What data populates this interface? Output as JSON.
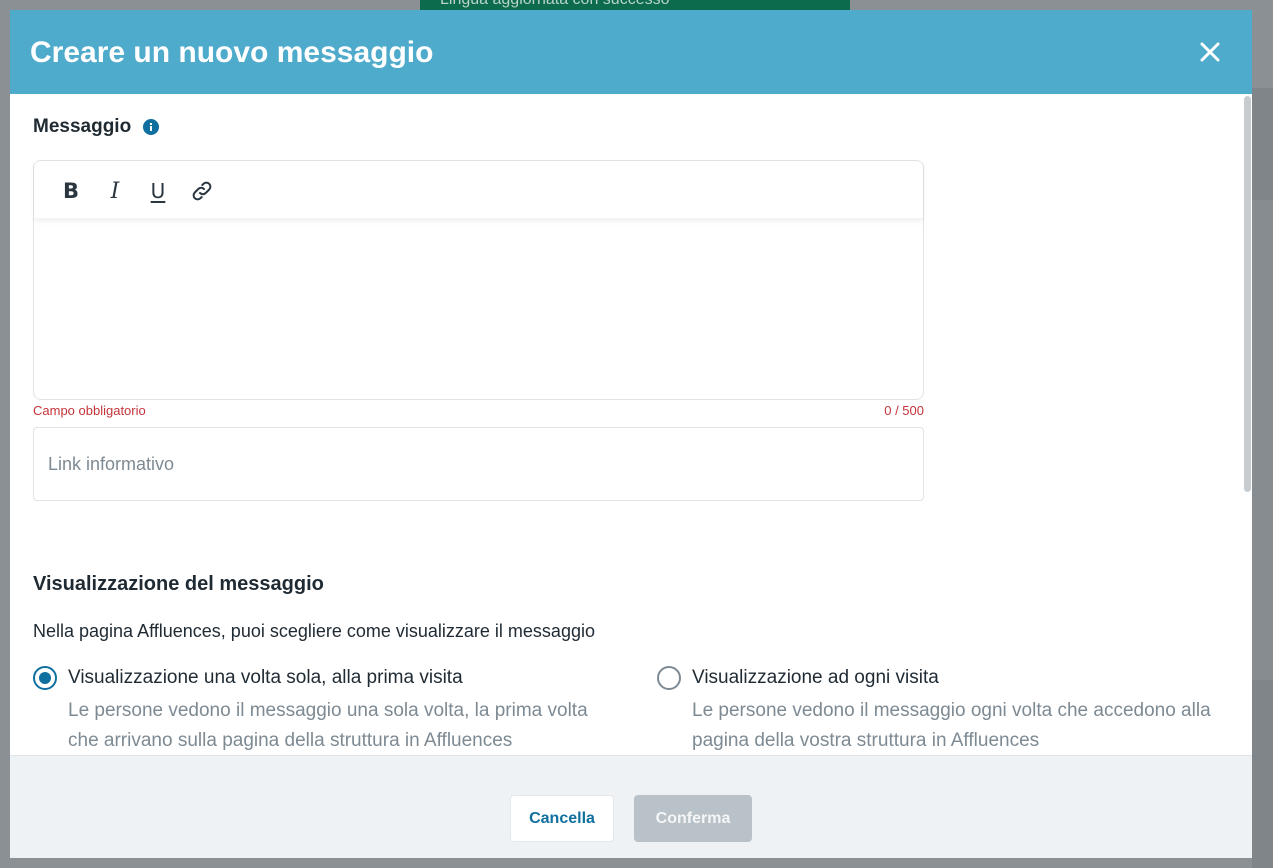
{
  "background": {
    "toast_text": "Lingua aggiornata con successo"
  },
  "modal": {
    "title": "Creare un nuovo messaggio",
    "close_icon": "close-icon"
  },
  "message_section": {
    "label": "Messaggio",
    "info_icon": "info-icon",
    "toolbar": {
      "bold": "B",
      "italic": "I",
      "underline": "U",
      "link_icon": "link-icon"
    },
    "editor_value": "",
    "error": "Campo obbligatorio",
    "char_count": "0 / 500",
    "link_input": {
      "value": "",
      "placeholder": "Link informativo"
    }
  },
  "visualization": {
    "title": "Visualizzazione del messaggio",
    "description": "Nella pagina Affluences, puoi scegliere come visualizzare il messaggio",
    "options": [
      {
        "label": "Visualizzazione una volta sola, alla prima visita",
        "help": "Le persone vedono il messaggio una sola volta, la prima volta che arrivano sulla pagina della struttura in Affluences",
        "selected": true
      },
      {
        "label": "Visualizzazione ad ogni visita",
        "help": "Le persone vedono il messaggio ogni volta che accedono alla pagina della vostra struttura in Affluences",
        "selected": false
      }
    ]
  },
  "footer": {
    "cancel_label": "Cancella",
    "confirm_label": "Conferma"
  },
  "colors": {
    "header": "#4fabcb",
    "primary": "#0f6f9f",
    "error": "#c4343a",
    "muted": "#7d8a93",
    "disabled_button": "#b9c2c8"
  }
}
